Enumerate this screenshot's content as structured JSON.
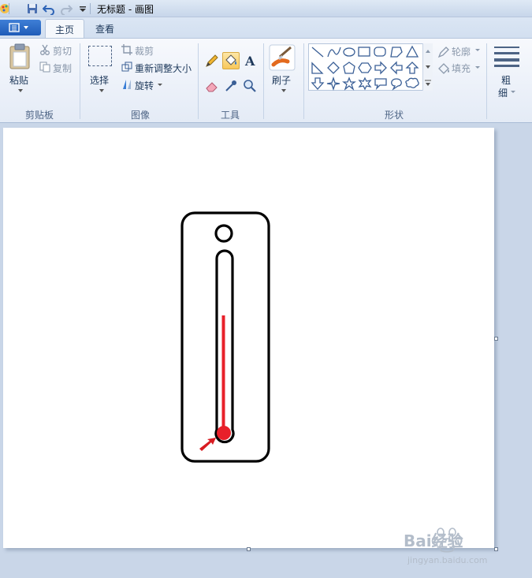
{
  "window": {
    "title": "无标题 - 画图"
  },
  "tabs": {
    "home": "主页",
    "view": "查看"
  },
  "clipboard": {
    "paste": "粘贴",
    "cut": "剪切",
    "copy": "复制",
    "group": "剪贴板"
  },
  "image": {
    "select": "选择",
    "crop": "裁剪",
    "resize": "重新调整大小",
    "rotate": "旋转",
    "group": "图像"
  },
  "tools": {
    "group": "工具",
    "selected_tool": "fill-icon"
  },
  "brushes": {
    "label": "刷子"
  },
  "shapes": {
    "outline": "轮廓",
    "fill": "填充",
    "group": "形状"
  },
  "size": {
    "label_line1": "粗",
    "label_line2": "细"
  },
  "drawing": {
    "outline_color": "#000000",
    "mercury_color": "#e8202a",
    "arrow_color": "#d81c22"
  },
  "watermark": {
    "brand": "Bai经验",
    "url": "jingyan.baidu.com"
  }
}
